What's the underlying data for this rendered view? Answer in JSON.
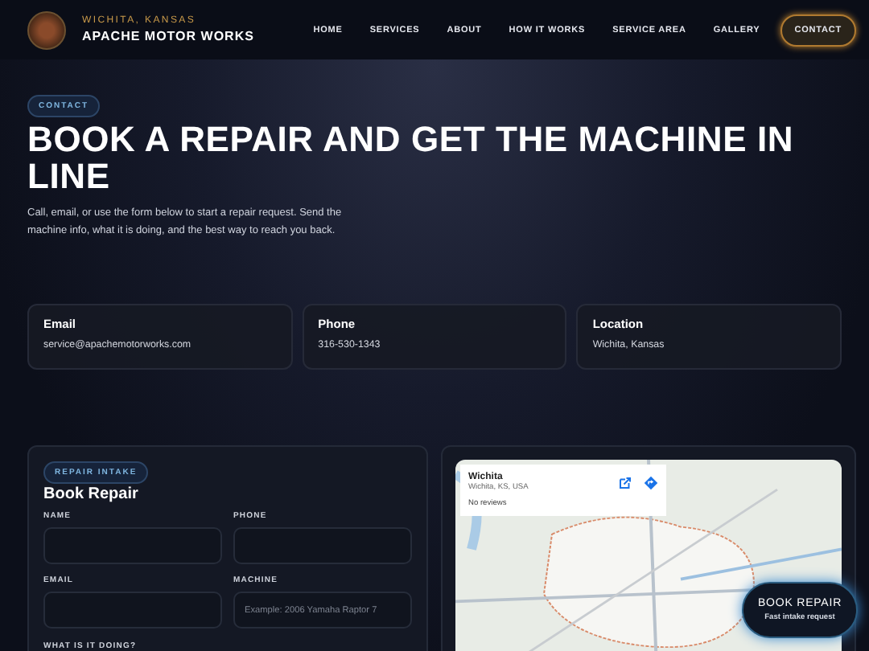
{
  "header": {
    "location": "WICHITA, KANSAS",
    "brand": "APACHE MOTOR WORKS",
    "nav": [
      {
        "label": "HOME",
        "selected": false
      },
      {
        "label": "SERVICES",
        "selected": false
      },
      {
        "label": "ABOUT",
        "selected": false
      },
      {
        "label": "HOW IT WORKS",
        "selected": false
      },
      {
        "label": "SERVICE AREA",
        "selected": false
      },
      {
        "label": "GALLERY",
        "selected": false
      },
      {
        "label": "CONTACT",
        "selected": true
      }
    ]
  },
  "hero": {
    "badge": "CONTACT",
    "title": "BOOK A REPAIR AND GET THE MACHINE IN LINE",
    "text": "Call, email, or use the form below to start a repair request. Send the machine info, what it is doing, and the best way to reach you back."
  },
  "contact_cards": [
    {
      "label": "Email",
      "value": "service@apachemotorworks.com"
    },
    {
      "label": "Phone",
      "value": "316-530-1343"
    },
    {
      "label": "Location",
      "value": "Wichita, Kansas"
    }
  ],
  "form": {
    "badge": "REPAIR INTAKE",
    "title": "Book Repair",
    "fields": [
      {
        "label": "NAME"
      },
      {
        "label": "PHONE"
      },
      {
        "label": "EMAIL"
      },
      {
        "label": "MACHINE",
        "placeholder": "Example: 2006 Yamaha Raptor 7"
      }
    ],
    "next_label": "WHAT IS IT DOING?"
  },
  "map": {
    "place": "Wichita",
    "address": "Wichita, KS, USA",
    "reviews": "No reviews"
  },
  "floating_button": {
    "label": "BOOK REPAIR",
    "sub": "Fast intake request"
  }
}
